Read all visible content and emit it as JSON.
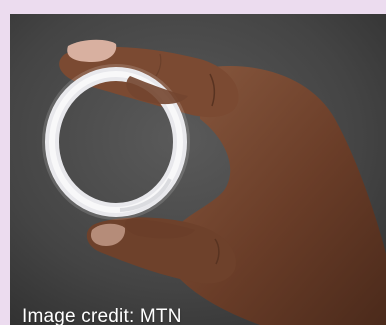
{
  "photo": {
    "subject": "hand holding white silicone ring",
    "credit_text": "Image credit: MTN"
  },
  "colors": {
    "page_background": "#ecdcef",
    "photo_background": "#4a4a4a",
    "ring": "#f3f3f5",
    "skin": "#7a4a33",
    "credit_text": "#ffffff"
  }
}
